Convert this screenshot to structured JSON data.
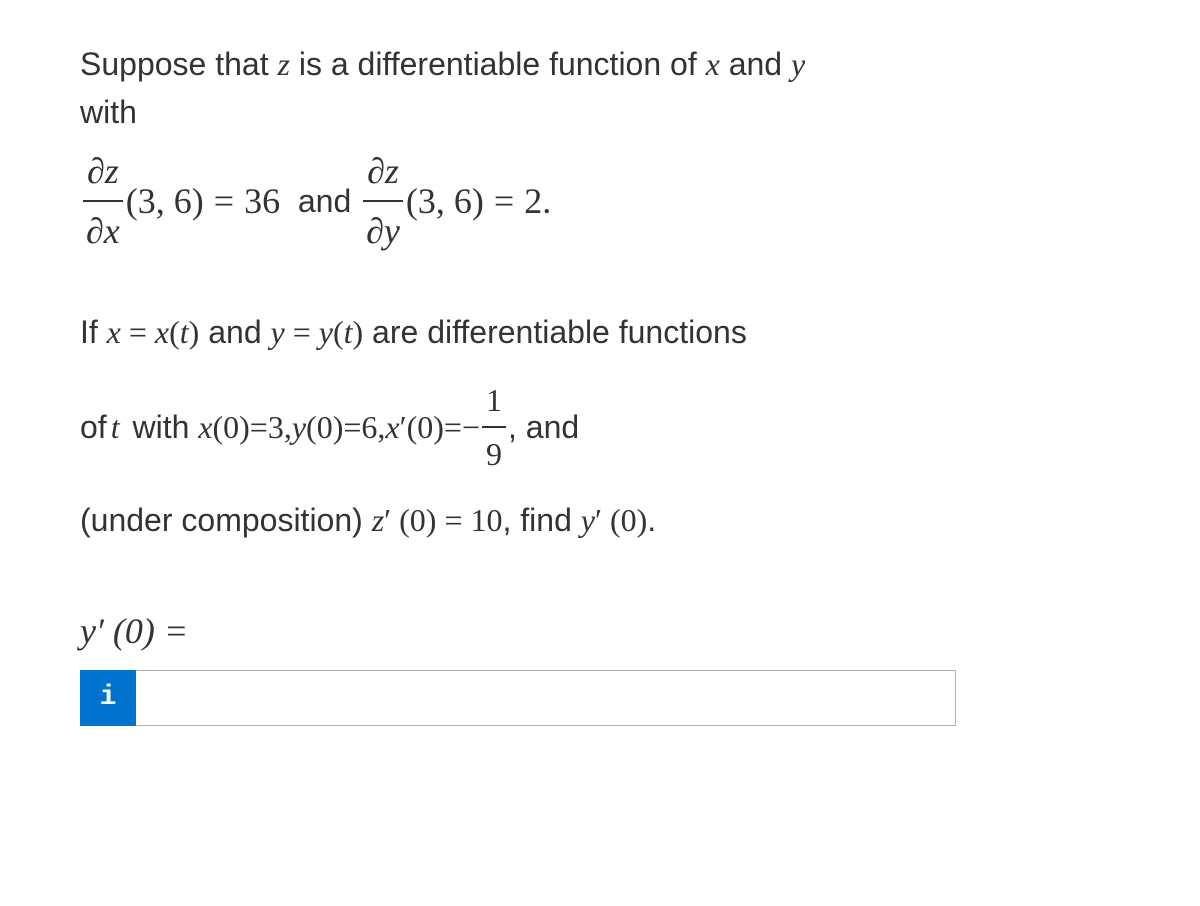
{
  "intro": {
    "line1_prefix": "Suppose that ",
    "var_z": "z",
    "line1_mid": " is a differentiable function of ",
    "var_x": "x",
    "line1_and": " and ",
    "var_y": "y",
    "line2": "with"
  },
  "equation": {
    "partial": "∂",
    "dz_num1": "∂z",
    "dx_den": "∂x",
    "point1": "(3, 6)",
    "eq": " = ",
    "val1": "36",
    "and_text": "  and ",
    "dz_num2": "∂z",
    "dy_den": "∂y",
    "point2": "(3, 6)",
    "val2": "2",
    "period": " ."
  },
  "paragraph": {
    "p1_prefix": "If ",
    "p1_x": "x",
    "p1_eq1": " = ",
    "p1_xt": "x",
    "p1_paren_t1": "(",
    "p1_t1": "t",
    "p1_paren_t1c": ")",
    "p1_and1": " and ",
    "p1_y": "y",
    "p1_eq2": " = ",
    "p1_yt": "y",
    "p1_paren_t2": "(",
    "p1_t2": "t",
    "p1_paren_t2c": ")",
    "p1_suffix": " are differentiable functions",
    "p2_prefix": "of ",
    "p2_t": "t",
    "p2_with": " with ",
    "p2_x0": "x",
    "p2_x0_arg": "(0)",
    "p2_eq1": " = ",
    "p2_val1": "3, ",
    "p2_y0": "y",
    "p2_y0_arg": "(0)",
    "p2_eq2": " = ",
    "p2_val2": "6, ",
    "p2_xprime": "x",
    "p2_prime1": "′",
    "p2_xp_arg": " (0)",
    "p2_eq3": " = ",
    "p2_neg": " − ",
    "p2_frac_num": "1",
    "p2_frac_den": "9",
    "p2_comma_and": ", and",
    "p3_prefix": "(under composition) ",
    "p3_z": "z",
    "p3_prime": "′",
    "p3_arg": " (0)",
    "p3_eq": " = ",
    "p3_val": " 10",
    "p3_find": ", find ",
    "p3_y": "y",
    "p3_prime2": "′",
    "p3_yarg": " (0)",
    "p3_period": "."
  },
  "answer": {
    "label_y": "y",
    "label_prime": "′",
    "label_arg": " (0)",
    "label_eq": " =",
    "info_icon": "i",
    "input_value": ""
  }
}
